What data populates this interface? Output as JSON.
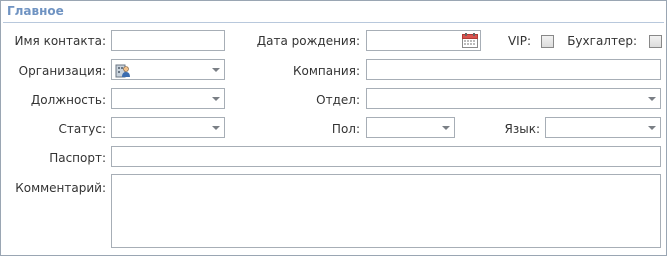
{
  "section": {
    "title": "Главное"
  },
  "fields": {
    "contact_name": {
      "label": "Имя контакта:",
      "value": ""
    },
    "birth_date": {
      "label": "Дата рождения:",
      "value": ""
    },
    "vip": {
      "label": "VIP:",
      "checked": false
    },
    "accountant": {
      "label": "Бухгалтер:",
      "checked": false
    },
    "organization": {
      "label": "Организация:",
      "value": ""
    },
    "company": {
      "label": "Компания:",
      "value": ""
    },
    "position": {
      "label": "Должность:",
      "value": ""
    },
    "department": {
      "label": "Отдел:",
      "value": ""
    },
    "status": {
      "label": "Статус:",
      "value": ""
    },
    "gender": {
      "label": "Пол:",
      "value": ""
    },
    "language": {
      "label": "Язык:",
      "value": ""
    },
    "passport": {
      "label": "Паспорт:",
      "value": ""
    },
    "comment": {
      "label": "Комментарий:",
      "value": ""
    }
  },
  "icons": {
    "calendar": "calendar-icon",
    "organization": "organization-person-icon",
    "dropdown": "chevron-down-icon"
  },
  "colors": {
    "title": "#6f93c2",
    "border": "#a7aeb6",
    "calendar_accent": "#d9534f"
  }
}
